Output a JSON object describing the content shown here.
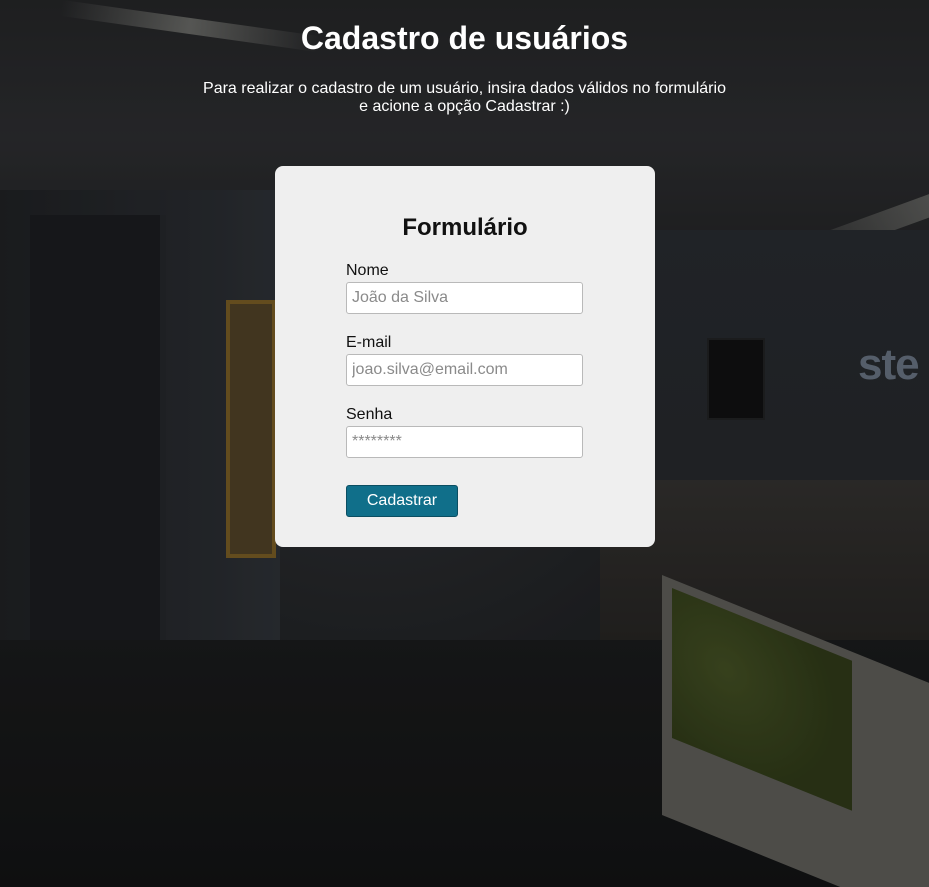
{
  "header": {
    "title": "Cadastro de usuários",
    "subtitle_line1": "Para realizar o cadastro de um usuário, insira dados válidos no formulário",
    "subtitle_line2": "e acione a opção Cadastrar :)"
  },
  "form": {
    "title": "Formulário",
    "fields": [
      {
        "label": "Nome",
        "placeholder": "João da Silva",
        "value": ""
      },
      {
        "label": "E-mail",
        "placeholder": "joao.silva@email.com",
        "value": ""
      },
      {
        "label": "Senha",
        "placeholder": "********",
        "value": ""
      }
    ],
    "submit_label": "Cadastrar"
  },
  "background": {
    "logo_text": "ste"
  },
  "colors": {
    "card_background": "#efefef",
    "button_background": "#106f8a",
    "title_text": "#ffffff"
  }
}
